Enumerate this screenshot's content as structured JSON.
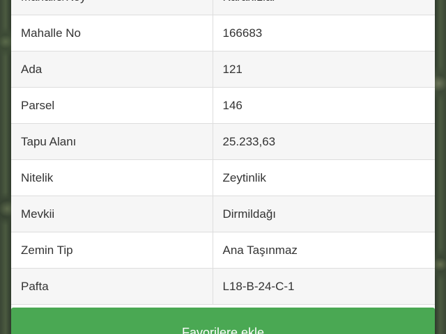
{
  "parcel_info": {
    "rows": [
      {
        "key": "Mahalle/Köy",
        "value": "Karakızlar"
      },
      {
        "key": "Mahalle No",
        "value": "166683"
      },
      {
        "key": "Ada",
        "value": "121"
      },
      {
        "key": "Parsel",
        "value": "146"
      },
      {
        "key": "Tapu Alanı",
        "value": "25.233,63"
      },
      {
        "key": "Nitelik",
        "value": "Zeytinlik"
      },
      {
        "key": "Mevkii",
        "value": "Dirmildağı"
      },
      {
        "key": "Zemin Tip",
        "value": "Ana Taşınmaz"
      },
      {
        "key": "Pafta",
        "value": "L18-B-24-C-1"
      }
    ]
  },
  "actions": {
    "add_favorites_label": "Favorilere ekle"
  }
}
